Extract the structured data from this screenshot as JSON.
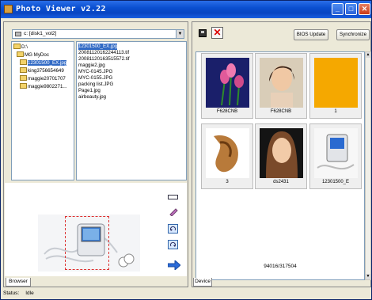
{
  "window": {
    "title": "Photo Viewer v2.22",
    "min_glyph": "_",
    "max_glyph": "□",
    "close_glyph": "✕"
  },
  "left": {
    "drive_select": "c: [disk1_vol2]",
    "tree": [
      {
        "label": "D:\\"
      },
      {
        "label": "MG MyDoc"
      },
      {
        "label": "12301500_EX.jpg"
      },
      {
        "label": "king3756654649"
      },
      {
        "label": "maggie20701707"
      },
      {
        "label": "maggie9802271..."
      }
    ],
    "files": [
      "12301500_EX.jpg",
      "20081120162244113.tif",
      "20081120163515572.tif",
      "maggie2.jpg",
      "MYC-0145.JPG",
      "MYC-0155.JPG",
      "packing list.JPG",
      "Page1.jpg",
      "airbeauty.jpg"
    ],
    "tab_label": "Browser"
  },
  "right": {
    "bios_label": "BIOS Update",
    "sync_label": "Synchronize",
    "thumbs": [
      {
        "caption": "F628CNB"
      },
      {
        "caption": "F628CNB"
      },
      {
        "caption": "1"
      },
      {
        "caption": "3"
      },
      {
        "caption": "ds2431"
      },
      {
        "caption": "12301500_E"
      }
    ],
    "capacity": "94016/317504",
    "tab_label": "Device"
  },
  "status": {
    "label": "Status:",
    "value": "Idle"
  },
  "colors": {
    "titlebar": "#0a4fd0",
    "selection": "#316ac5",
    "orange_thumb": "#f5a800"
  }
}
